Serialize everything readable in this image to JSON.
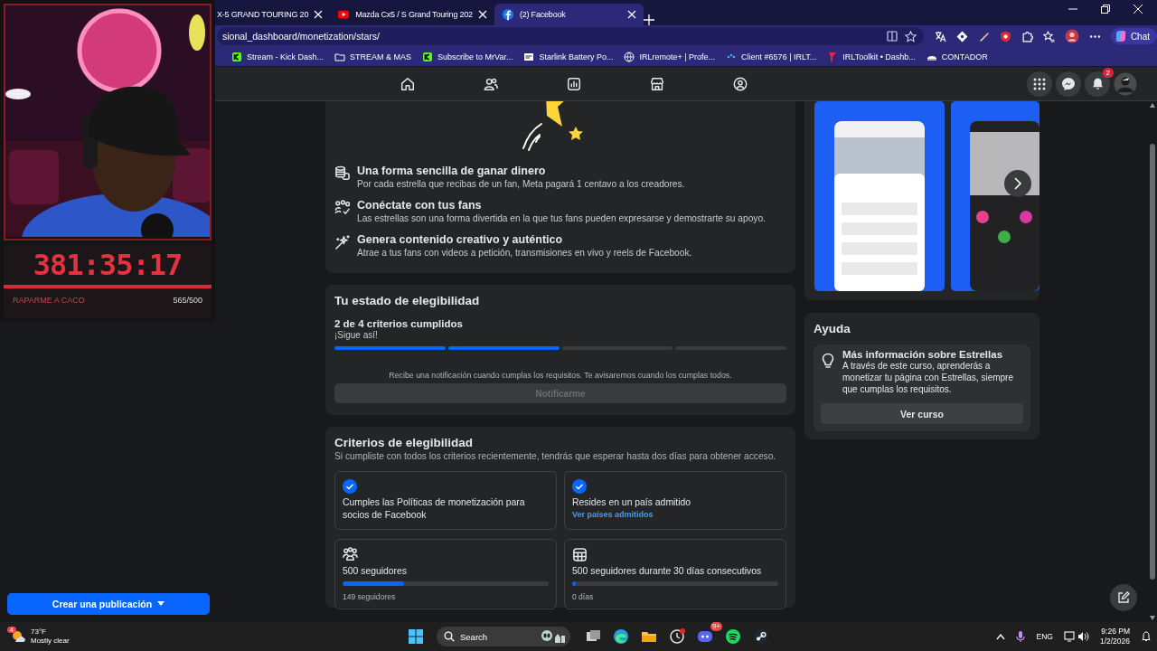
{
  "browser": {
    "tabs": [
      {
        "title": "X-5 GRAND TOURING 20",
        "selected": false
      },
      {
        "title": "Mazda Cx5 / S Grand Touring 202",
        "selected": false
      },
      {
        "title": "(2) Facebook",
        "selected": true
      }
    ],
    "address": "sional_dashboard/monetization/stars/",
    "chat_button": "Chat",
    "bookmarks": [
      "Stream - Kick Dash...",
      "STREAM & MAS",
      "Subscribe to MrVar...",
      "Starlink Battery Po...",
      "IRLremote+ | Profe...",
      "Client #6576 | IRLT...",
      "IRLToolkit • Dashb...",
      "CONTADOR"
    ]
  },
  "stream_overlay": {
    "timer": "381:35:17",
    "goal_label": "RAPARME A CACO",
    "goal_count": "565/500"
  },
  "top_nav": {
    "notification_count": "2"
  },
  "left_sidebar": {
    "create_button": "Crear una publicación"
  },
  "features": [
    {
      "title": "Una forma sencilla de ganar dinero",
      "description": "Por cada estrella que recibas de un fan, Meta pagará 1 centavo a los creadores."
    },
    {
      "title": "Conéctate con tus fans",
      "description": "Las estrellas son una forma divertida en la que tus fans pueden expresarse y demostrarte su apoyo."
    },
    {
      "title": "Genera contenido creativo y auténtico",
      "description": "Atrae a tus fans con videos a petición, transmisiones en vivo y reels de Facebook."
    }
  ],
  "eligibility_status": {
    "title": "Tu estado de elegibilidad",
    "summary": "2 de 4 criterios cumplidos",
    "encouragement": "¡Sigue así!",
    "steps": [
      {
        "done": true
      },
      {
        "done": true
      },
      {
        "done": false
      },
      {
        "done": false
      }
    ],
    "notice": "Recibe una notificación cuando cumplas los requisitos. Te avisaremos cuando los cumplas todos.",
    "notify_button": {
      "label": "Notificarme",
      "disabled": true
    }
  },
  "criteria": {
    "title": "Criterios de elegibilidad",
    "subtitle": "Si cumpliste con todos los criterios recientemente, tendrás que esperar hasta dos días para obtener acceso.",
    "items": [
      {
        "kind": "check",
        "met": true,
        "text": "Cumples las Políticas de monetización para socios de Facebook"
      },
      {
        "kind": "check",
        "met": true,
        "text": "Resides en un país admitido",
        "link": "Ver países admitidos"
      },
      {
        "kind": "progress",
        "text": "500 seguidores",
        "level": 0.3,
        "caption": "149 seguidores"
      },
      {
        "kind": "progress",
        "text": "500 seguidores durante 30 días consecutivos",
        "level": 0.01,
        "caption": "0 días"
      }
    ]
  },
  "help": {
    "title": "Ayuda",
    "card_title": "Más información sobre Estrellas",
    "card_text": "A través de este curso, aprenderás a monetizar tu página con Estrellas, siempre que cumplas los requisitos.",
    "button": "Ver curso"
  },
  "taskbar": {
    "weather_badge": "4",
    "temperature": "73°F",
    "weather": "Mostly clear",
    "search": "Search",
    "chat_badge": "9+",
    "language": "ENG",
    "time": "9:26 PM",
    "date": "1/2/2026"
  }
}
